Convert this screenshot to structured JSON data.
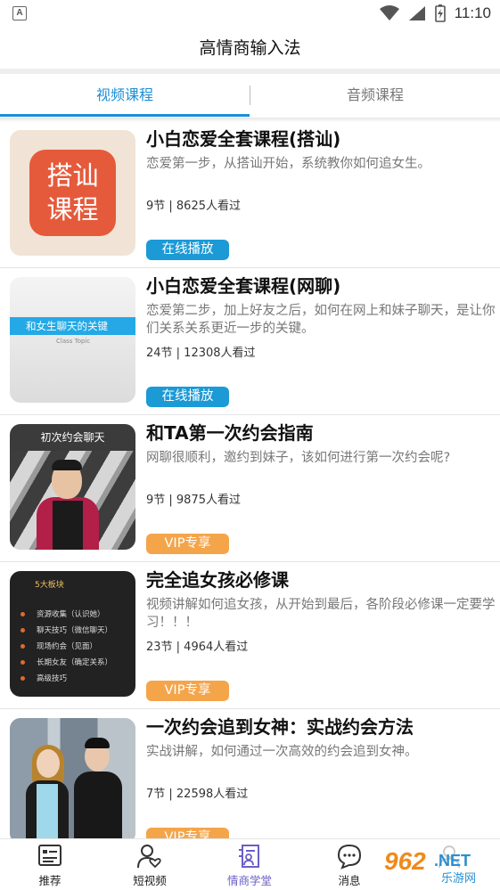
{
  "status_bar": {
    "time": "11:10",
    "left_icon_letter": "A"
  },
  "header": {
    "title": "高情商输入法"
  },
  "tabs": [
    {
      "label": "视频课程",
      "active": true
    },
    {
      "label": "音频课程",
      "active": false
    }
  ],
  "courses": [
    {
      "title": "小白恋爱全套课程(搭讪)",
      "description": "恋爱第一步，从搭讪开始，系统教你如何追女生。",
      "meta": "9节 | 8625人看过",
      "badge": "在线播放",
      "badge_type": "play",
      "thumb_text": [
        "搭讪",
        "课程"
      ]
    },
    {
      "title": "小白恋爱全套课程(网聊)",
      "description": "恋爱第二步，加上好友之后，如何在网上和妹子聊天，是让你们关系关系更近一步的关键。",
      "meta": "24节 | 12308人看过",
      "badge": "在线播放",
      "badge_type": "play",
      "thumb_text": [
        "和女生聊天的关键",
        "Class Topic"
      ]
    },
    {
      "title": "和TA第一次约会指南",
      "description": "网聊很顺利，邀约到妹子，该如何进行第一次约会呢?",
      "meta": "9节 | 9875人看过",
      "badge": "VIP专享",
      "badge_type": "vip",
      "thumb_text": [
        "初次约会聊天"
      ]
    },
    {
      "title": "完全追女孩必修课",
      "description": "视频讲解如何追女孩，从开始到最后，各阶段必修课一定要学习！！！",
      "meta": "23节 | 4964人看过",
      "badge": "VIP专享",
      "badge_type": "vip",
      "thumb_text": [
        "5大板块",
        "资源收集（认识她）",
        "聊天技巧（微信聊天）",
        "现场约会（见面）",
        "长期女友（确定关系）",
        "高级技巧"
      ]
    },
    {
      "title": "一次约会追到女神：实战约会方法",
      "description": "实战讲解，如何通过一次高效的约会追到女神。",
      "meta": "7节 | 22598人看过",
      "badge": "VIP专享",
      "badge_type": "vip",
      "thumb_text": []
    }
  ],
  "bottom_nav": [
    {
      "label": "推荐",
      "icon": "list-card-icon",
      "active": false
    },
    {
      "label": "短视频",
      "icon": "person-heart-icon",
      "active": false
    },
    {
      "label": "情商学堂",
      "icon": "book-person-icon",
      "active": true
    },
    {
      "label": "消息",
      "icon": "chat-bubble-icon",
      "active": false
    },
    {
      "label": "",
      "icon": "profile-icon",
      "active": false
    }
  ],
  "watermark": {
    "text_top": "962",
    "text_net": ".NET",
    "text_bottom": "乐游网"
  },
  "colors": {
    "accent": "#1a8fd6",
    "play_badge": "#1b9ad6",
    "vip_badge": "#f4a54a",
    "nav_active": "#6a5fc8"
  }
}
